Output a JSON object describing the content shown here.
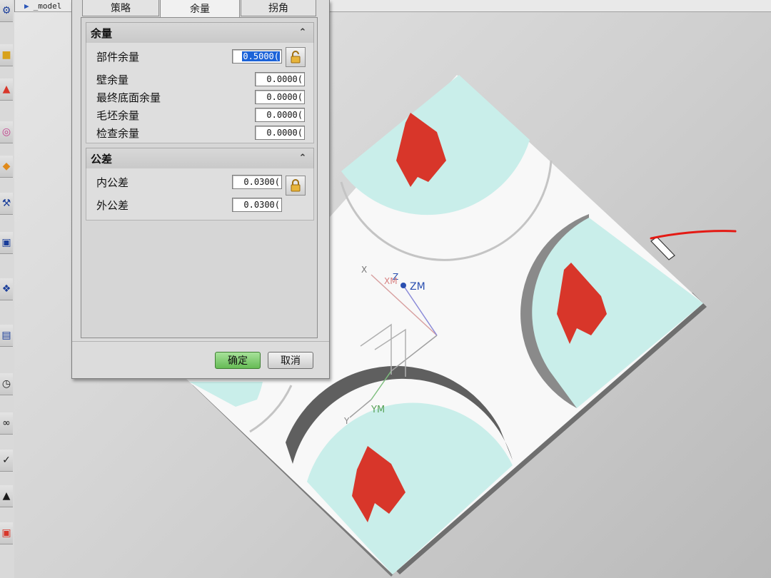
{
  "window": {
    "model_tab": "_model"
  },
  "dialog": {
    "tabs": [
      {
        "label": "策略"
      },
      {
        "label": "余量"
      },
      {
        "label": "拐角"
      }
    ],
    "active_tab": "余量",
    "stock_group": {
      "title": "余量",
      "rows": [
        {
          "label": "部件余量",
          "value": "0.5000("
        },
        {
          "label": "壁余量",
          "value": "0.0000("
        },
        {
          "label": "最终底面余量",
          "value": "0.0000("
        },
        {
          "label": "毛坯余量",
          "value": "0.0000("
        },
        {
          "label": "检查余量",
          "value": "0.0000("
        }
      ]
    },
    "tolerance_group": {
      "title": "公差",
      "rows": [
        {
          "label": "内公差",
          "value": "0.0300("
        },
        {
          "label": "外公差",
          "value": "0.0300("
        }
      ]
    },
    "ok_label": "确定",
    "cancel_label": "取消"
  },
  "axis_labels": {
    "x": "X",
    "z": "Z",
    "xm": "XM",
    "zm": "ZM",
    "ym": "YM",
    "y": "Y"
  },
  "colors": {
    "toolpath_red": "#d8362a",
    "floor_cyan": "#c8eeea",
    "part_white": "#ffffff",
    "wall_gray": "#6f6f6f",
    "annotation_red": "#e41a14",
    "ok_green": "#7cc86a"
  }
}
